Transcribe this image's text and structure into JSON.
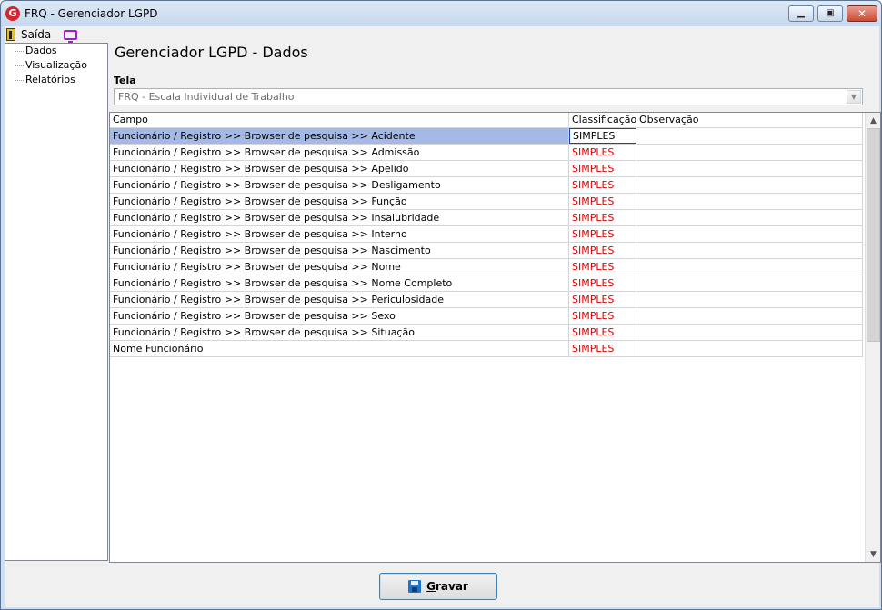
{
  "window": {
    "title": "FRQ - Gerenciador LGPD",
    "app_icon_letter": "G",
    "minimize_glyph": "▁",
    "maximize_glyph": "▣",
    "close_glyph": "✕"
  },
  "menu": {
    "exit_label": "Saída",
    "exit_icon": "exit-door-icon",
    "monitor_icon": "monitor-icon"
  },
  "tree": {
    "items": [
      {
        "label": "Dados"
      },
      {
        "label": "Visualização"
      },
      {
        "label": "Relatórios"
      }
    ]
  },
  "main": {
    "title": "Gerenciador LGPD - Dados",
    "screen_label": "Tela",
    "screen_value": "FRQ - Escala Individual de Trabalho",
    "dropdown_glyph": "▼"
  },
  "grid": {
    "columns": [
      "Campo",
      "Classificação",
      "Observação"
    ],
    "selected_row": 0,
    "rows": [
      {
        "campo": "Funcionário / Registro >> Browser de pesquisa >> Acidente",
        "classificacao": "SIMPLES",
        "observacao": ""
      },
      {
        "campo": "Funcionário / Registro >> Browser de pesquisa >> Admissão",
        "classificacao": "SIMPLES",
        "observacao": ""
      },
      {
        "campo": "Funcionário / Registro >> Browser de pesquisa >> Apelido",
        "classificacao": "SIMPLES",
        "observacao": ""
      },
      {
        "campo": "Funcionário / Registro >> Browser de pesquisa >> Desligamento",
        "classificacao": "SIMPLES",
        "observacao": ""
      },
      {
        "campo": "Funcionário / Registro >> Browser de pesquisa >> Função",
        "classificacao": "SIMPLES",
        "observacao": ""
      },
      {
        "campo": "Funcionário / Registro >> Browser de pesquisa >> Insalubridade",
        "classificacao": "SIMPLES",
        "observacao": ""
      },
      {
        "campo": "Funcionário / Registro >> Browser de pesquisa >> Interno",
        "classificacao": "SIMPLES",
        "observacao": ""
      },
      {
        "campo": "Funcionário / Registro >> Browser de pesquisa >> Nascimento",
        "classificacao": "SIMPLES",
        "observacao": ""
      },
      {
        "campo": "Funcionário / Registro >> Browser de pesquisa >> Nome",
        "classificacao": "SIMPLES",
        "observacao": ""
      },
      {
        "campo": "Funcionário / Registro >> Browser de pesquisa >> Nome Completo",
        "classificacao": "SIMPLES",
        "observacao": ""
      },
      {
        "campo": "Funcionário / Registro >> Browser de pesquisa >> Periculosidade",
        "classificacao": "SIMPLES",
        "observacao": ""
      },
      {
        "campo": "Funcionário / Registro >> Browser de pesquisa >> Sexo",
        "classificacao": "SIMPLES",
        "observacao": ""
      },
      {
        "campo": "Funcionário / Registro >> Browser de pesquisa >> Situação",
        "classificacao": "SIMPLES",
        "observacao": ""
      },
      {
        "campo": "Nome Funcionário",
        "classificacao": "SIMPLES",
        "observacao": ""
      }
    ],
    "scroll_up_glyph": "▲",
    "scroll_down_glyph": "▼"
  },
  "footer": {
    "save_label_accel": "G",
    "save_label_rest": "ravar",
    "save_icon": "floppy-disk-icon"
  },
  "colors": {
    "selected_row": "#a4b9e5",
    "classification_text": "#e00000",
    "window_frame": "#cfdff0"
  }
}
